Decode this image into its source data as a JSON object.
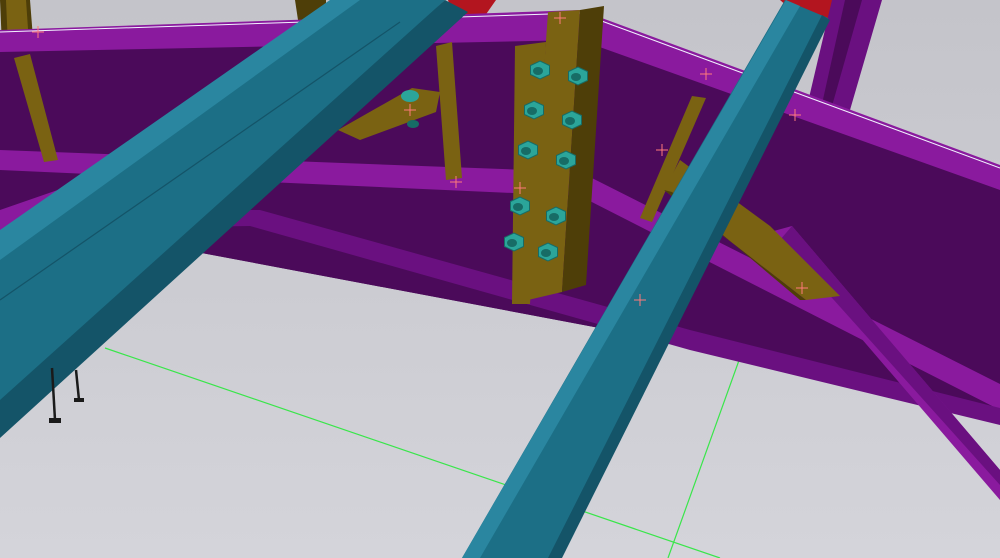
{
  "viewport": {
    "background_top": "#c4c4ca",
    "background_bottom": "#d4d4da"
  },
  "colors": {
    "rafter_web": "#4b0a5a",
    "rafter_flange": "#8a1a9e",
    "rafter_flange_dark": "#6a1080",
    "rafter_edge": "#a020b8",
    "purlin_main": "#1c6f86",
    "purlin_light": "#2a86a0",
    "purlin_dark": "#145468",
    "plate": "#7a6212",
    "plate_light": "#8e7418",
    "plate_dark": "#4e3e08",
    "bolt": "#2ba59a",
    "bolt_dark": "#176c66",
    "end_cap": "#b3151f",
    "grid_line": "#39e64a",
    "work_plane_line": "#f2f2ff",
    "reference_mark": "#ff7a7a",
    "anchor_bolt": "#1a1a1a"
  }
}
